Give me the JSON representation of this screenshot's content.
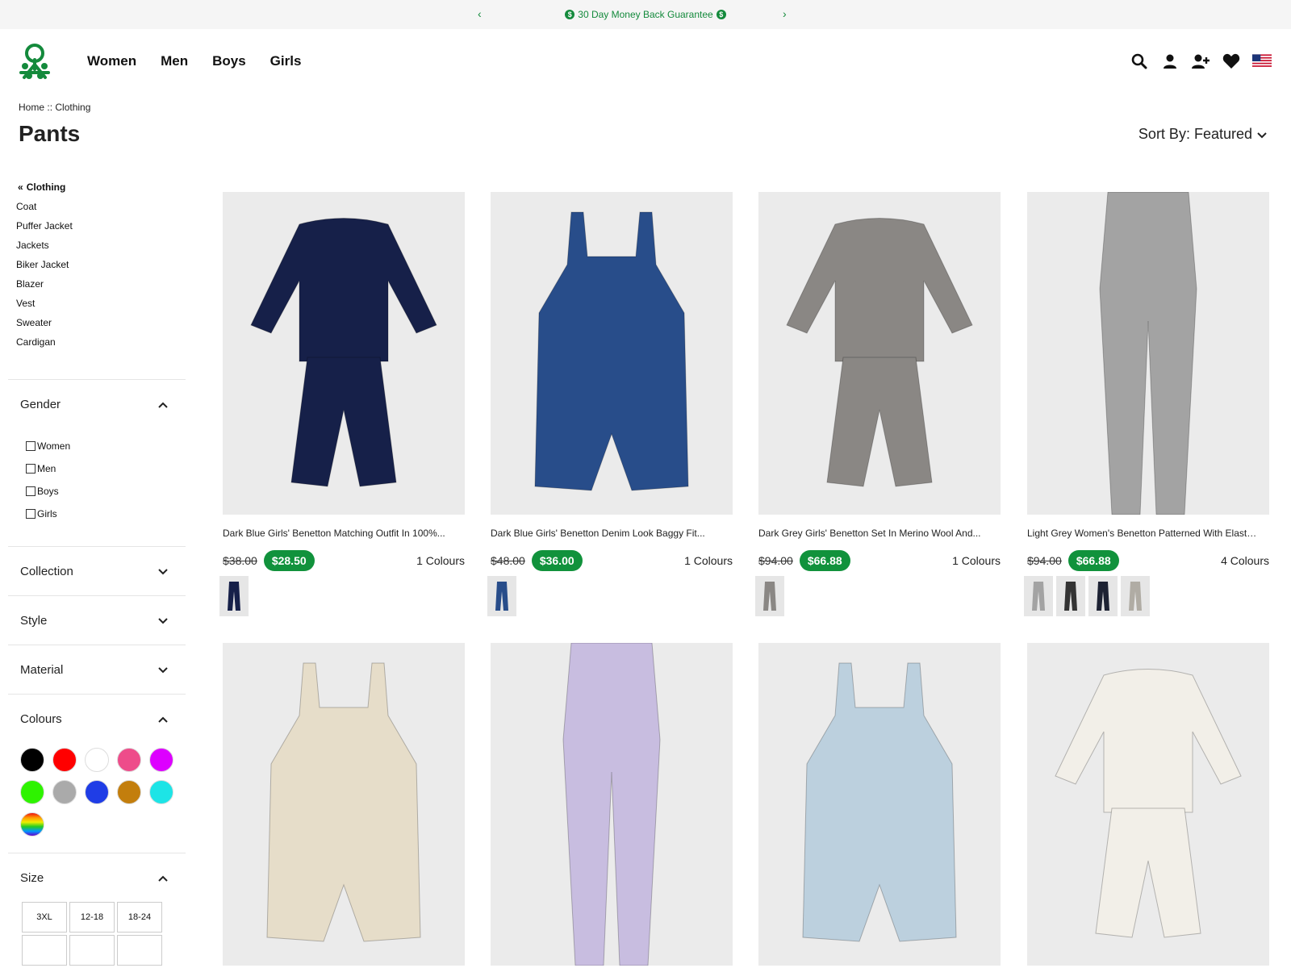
{
  "promo": {
    "text": "30 Day Money Back Guarantee",
    "prev": "‹",
    "next": "›"
  },
  "nav": [
    "Women",
    "Men",
    "Boys",
    "Girls"
  ],
  "breadcrumb": {
    "home": "Home",
    "sep": "::",
    "current": "Clothing"
  },
  "page_title": "Pants",
  "sort": {
    "label": "Sort By: Featured"
  },
  "categories": {
    "parent": "Clothing",
    "items": [
      "Coat",
      "Puffer Jacket",
      "Jackets",
      "Biker Jacket",
      "Blazer",
      "Vest",
      "Sweater",
      "Cardigan"
    ]
  },
  "filters": {
    "gender": {
      "label": "Gender",
      "options": [
        "Women",
        "Men",
        "Boys",
        "Girls"
      ]
    },
    "collection": {
      "label": "Collection"
    },
    "style": {
      "label": "Style"
    },
    "material": {
      "label": "Material"
    },
    "colours": {
      "label": "Colours",
      "swatches": [
        "#000000",
        "#ff0000",
        "#ffffff",
        "#ee4c8a",
        "#dd00ff",
        "#2ef300",
        "#aaaaaa",
        "#1f3de6",
        "#c37e0d",
        "#1de4e6",
        "rainbow"
      ]
    },
    "size": {
      "label": "Size",
      "options": [
        "3XL",
        "12-18",
        "18-24",
        "",
        "",
        ""
      ]
    }
  },
  "products": [
    {
      "name": "Dark Blue Girls' Benetton Matching Outfit In 100%...",
      "old_price": "$38.00",
      "price": "$28.50",
      "colours": "1 Colours",
      "garment_color": "#162049",
      "type": "outfit",
      "thumbs": [
        "#162049"
      ]
    },
    {
      "name": "Dark Blue Girls' Benetton Denim Look Baggy Fit...",
      "old_price": "$48.00",
      "price": "$36.00",
      "colours": "1 Colours",
      "garment_color": "#284d8a",
      "type": "overall",
      "thumbs": [
        "#284d8a"
      ]
    },
    {
      "name": "Dark Grey Girls' Benetton Set In Merino Wool And...",
      "old_price": "$94.00",
      "price": "$66.88",
      "colours": "1 Colours",
      "garment_color": "#8a8784",
      "type": "outfit",
      "thumbs": [
        "#8a8784"
      ]
    },
    {
      "name": "Light Grey Women's Benetton Patterned With Elastic...",
      "old_price": "$94.00",
      "price": "$66.88",
      "colours": "4 Colours",
      "garment_color": "#a3a3a3",
      "type": "pants",
      "thumbs": [
        "#a3a3a3",
        "#333333",
        "#1d2233",
        "#b0aca4"
      ]
    },
    {
      "name": "",
      "old_price": "",
      "price": "",
      "colours": "",
      "garment_color": "#e6ddc9",
      "type": "overall",
      "thumbs": []
    },
    {
      "name": "",
      "old_price": "",
      "price": "",
      "colours": "",
      "garment_color": "#c8bde0",
      "type": "pants",
      "thumbs": []
    },
    {
      "name": "",
      "old_price": "",
      "price": "",
      "colours": "",
      "garment_color": "#bcd0de",
      "type": "overall",
      "thumbs": []
    },
    {
      "name": "",
      "old_price": "",
      "price": "",
      "colours": "",
      "garment_color": "#f2efe8",
      "type": "outfit",
      "thumbs": []
    }
  ]
}
